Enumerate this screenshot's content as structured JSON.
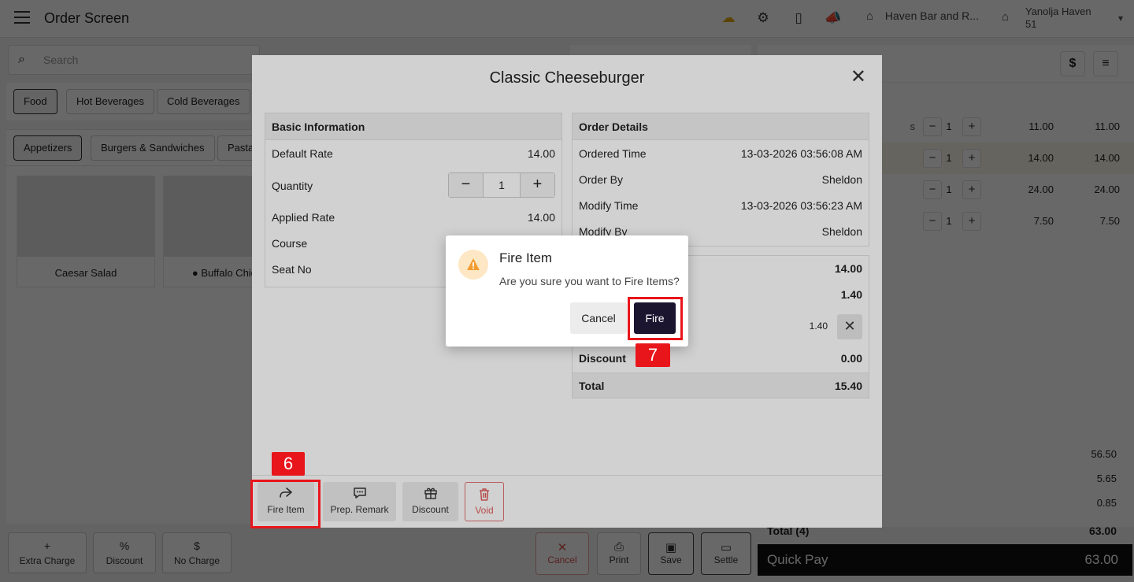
{
  "topbar": {
    "title": "Order Screen",
    "store_name": "Haven Bar and R...",
    "user_line1": "Yanolja Haven",
    "user_line2": "51"
  },
  "search": {
    "placeholder": "Search"
  },
  "categories": [
    "Food",
    "Hot Beverages",
    "Cold Beverages"
  ],
  "subcategories": [
    "Appetizers",
    "Burgers & Sandwiches",
    "Pasta"
  ],
  "menu_items": [
    "Caesar Salad",
    "Buffalo Chicken"
  ],
  "left_actions": [
    "Extra Charge",
    "Discount",
    "No Charge"
  ],
  "order_lines": [
    {
      "name": "s",
      "qty": "1",
      "rate": "11.00",
      "amount": "11.00"
    },
    {
      "name": "",
      "qty": "1",
      "rate": "14.00",
      "amount": "14.00"
    },
    {
      "name": "",
      "qty": "1",
      "rate": "24.00",
      "amount": "24.00"
    },
    {
      "name": "",
      "qty": "1",
      "rate": "7.50",
      "amount": "7.50"
    }
  ],
  "summary": {
    "subtotal": "56.50",
    "tax": "5.65",
    "other": "0.85",
    "total_label": "Total (4)",
    "total": "63.00"
  },
  "quick_pay": {
    "label": "Quick Pay",
    "amount": "63.00"
  },
  "right_actions": [
    "Cancel",
    "Print",
    "Save",
    "Settle"
  ],
  "modal": {
    "title": "Classic Cheeseburger",
    "basic": {
      "header": "Basic Information",
      "default_rate_label": "Default Rate",
      "default_rate": "14.00",
      "quantity_label": "Quantity",
      "quantity": "1",
      "applied_rate_label": "Applied Rate",
      "applied_rate": "14.00",
      "course_label": "Course",
      "seat_label": "Seat No"
    },
    "order": {
      "header": "Order Details",
      "ordered_time_label": "Ordered Time",
      "ordered_time": "13-03-2026 03:56:08 AM",
      "order_by_label": "Order By",
      "order_by": "Sheldon",
      "modify_time_label": "Modify Time",
      "modify_time": "13-03-2026 03:56:23 AM",
      "modify_by_label": "Modify By",
      "modify_by": "Sheldon"
    },
    "totals": {
      "line1": "14.00",
      "line2": "1.40",
      "tax_value": "1.40",
      "discount_label": "Discount",
      "discount": "0.00",
      "total_label": "Total",
      "total": "15.40"
    },
    "footer": {
      "fire": "Fire Item",
      "remark": "Prep. Remark",
      "discount": "Discount",
      "void": "Void"
    }
  },
  "dialog": {
    "title": "Fire Item",
    "message": "Are you sure you want to Fire Items?",
    "cancel": "Cancel",
    "confirm": "Fire"
  },
  "annotations": {
    "step6": "6",
    "step7": "7"
  },
  "colors": {
    "annotation": "#e8151b",
    "primary": "#1b1530",
    "void": "#e25b5b",
    "warning": "#f39c32"
  }
}
